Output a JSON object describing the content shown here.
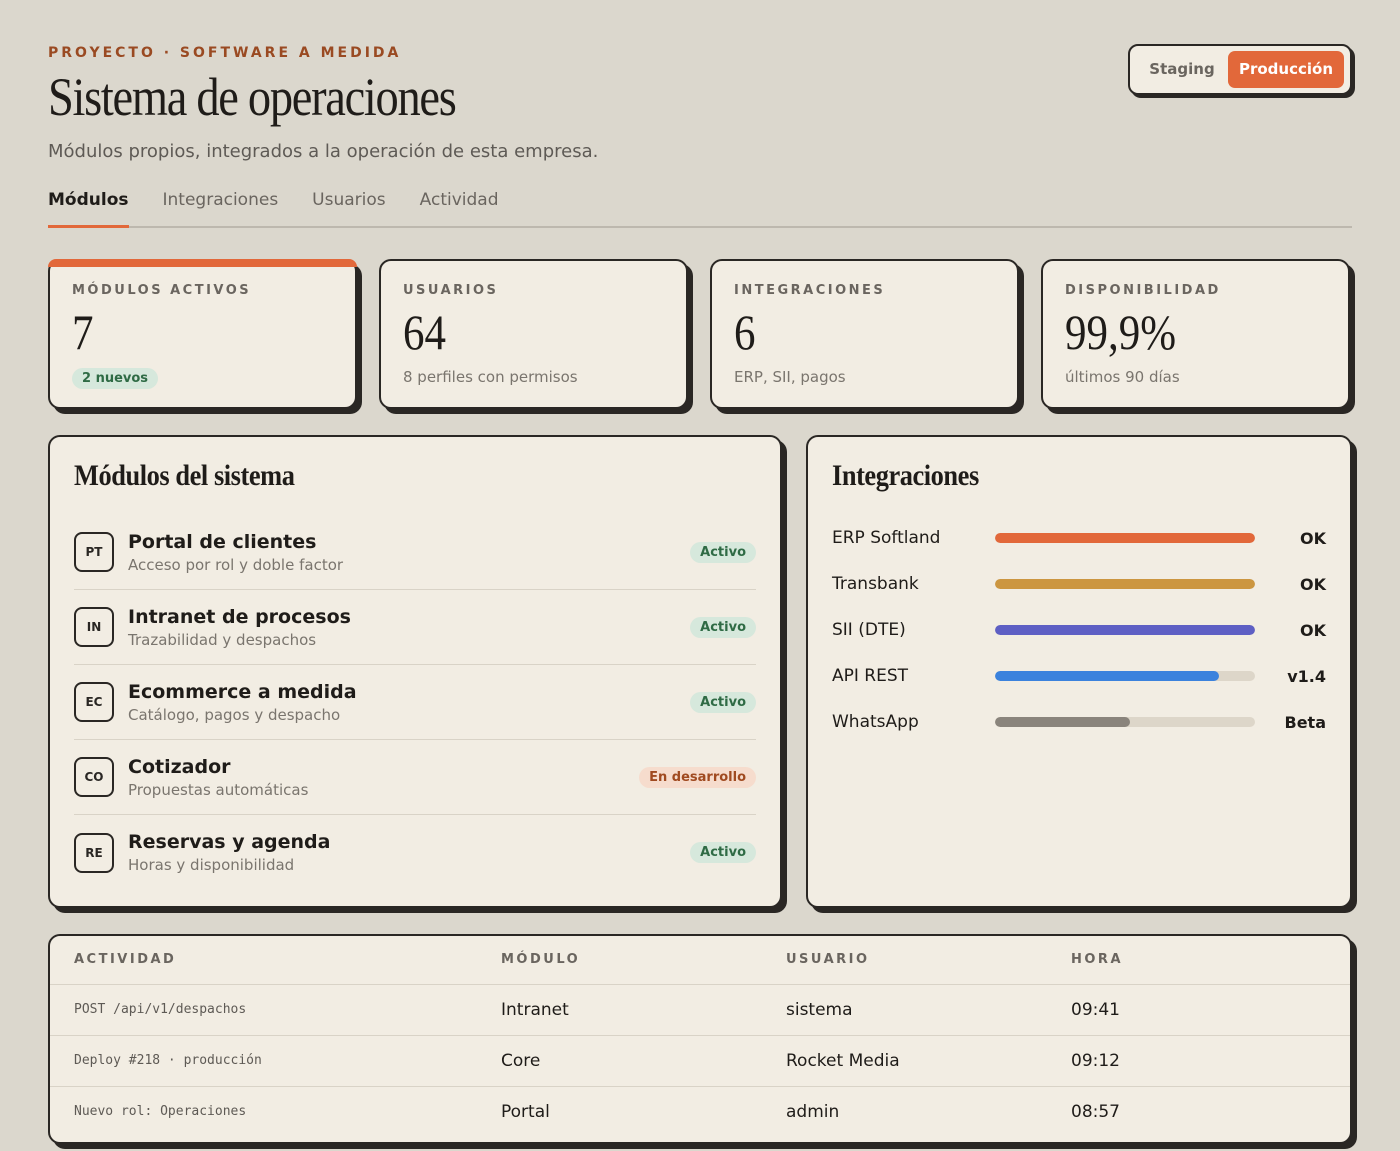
{
  "header": {
    "eyebrow": "PROYECTO · SOFTWARE A MEDIDA",
    "title": "Sistema de operaciones",
    "subtitle": "Módulos propios, integrados a la operación de esta empresa."
  },
  "environment": {
    "options": [
      "Staging",
      "Producción"
    ],
    "selected": "Producción",
    "accent": "#e2683a"
  },
  "tabs": [
    {
      "label": "Módulos",
      "active": true
    },
    {
      "label": "Integraciones",
      "active": false
    },
    {
      "label": "Usuarios",
      "active": false
    },
    {
      "label": "Actividad",
      "active": false
    }
  ],
  "stats": [
    {
      "label": "MÓDULOS ACTIVOS",
      "value": "7",
      "badge": "2 nuevos"
    },
    {
      "label": "USUARIOS",
      "value": "64",
      "note": "8 perfiles con permisos"
    },
    {
      "label": "INTEGRACIONES",
      "value": "6",
      "note": "ERP, SII, pagos"
    },
    {
      "label": "DISPONIBILIDAD",
      "value": "99,9%",
      "note": "últimos 90 días"
    }
  ],
  "modules": {
    "title": "Módulos del sistema",
    "items": [
      {
        "code": "PT",
        "name": "Portal de clientes",
        "desc": "Acceso por rol y doble factor",
        "status": "Activo"
      },
      {
        "code": "IN",
        "name": "Intranet de procesos",
        "desc": "Trazabilidad y despachos",
        "status": "Activo"
      },
      {
        "code": "EC",
        "name": "Ecommerce a medida",
        "desc": "Catálogo, pagos y despacho",
        "status": "Activo"
      },
      {
        "code": "CO",
        "name": "Cotizador",
        "desc": "Propuestas automáticas",
        "status": "En desarrollo"
      },
      {
        "code": "RE",
        "name": "Reservas y agenda",
        "desc": "Horas y disponibilidad",
        "status": "Activo"
      }
    ]
  },
  "integrations": {
    "title": "Integraciones",
    "items": [
      {
        "name": "ERP Softland",
        "status": "OK",
        "level": 1.0,
        "color": "#e2683a"
      },
      {
        "name": "Transbank",
        "status": "OK",
        "level": 1.0,
        "color": "#cc9640"
      },
      {
        "name": "SII (DTE)",
        "status": "OK",
        "level": 1.0,
        "color": "#5e5fc4"
      },
      {
        "name": "API REST",
        "status": "v1.4",
        "level": 0.86,
        "color": "#3b82dd"
      },
      {
        "name": "WhatsApp",
        "status": "Beta",
        "level": 0.52,
        "color": "#8a847c"
      }
    ]
  },
  "activity": {
    "headers": [
      "ACTIVIDAD",
      "MÓDULO",
      "USUARIO",
      "HORA"
    ],
    "rows": [
      [
        "POST /api/v1/despachos",
        "Intranet",
        "sistema",
        "09:41"
      ],
      [
        "Deploy #218 · producción",
        "Core",
        "Rocket Media",
        "09:12"
      ],
      [
        "Nuevo rol: Operaciones",
        "Portal",
        "admin",
        "08:57"
      ]
    ]
  }
}
